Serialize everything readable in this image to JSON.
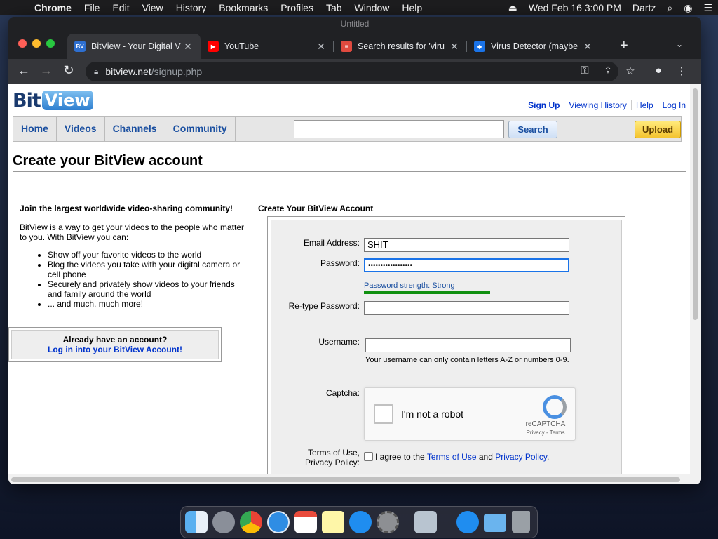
{
  "menubar": {
    "app": "Chrome",
    "items": [
      "File",
      "Edit",
      "View",
      "History",
      "Bookmarks",
      "Profiles",
      "Tab",
      "Window",
      "Help"
    ],
    "datetime": "Wed Feb 16  3:00 PM",
    "user": "Dartz"
  },
  "window": {
    "title": "Untitled"
  },
  "tabs": [
    {
      "title": "BitView - Your Digital V",
      "favicon": "bitview-favicon",
      "color": "#2e6fd0"
    },
    {
      "title": "YouTube",
      "favicon": "youtube-favicon",
      "color": "#ff0000"
    },
    {
      "title": "Search results for 'viru",
      "favicon": "search-favicon",
      "color": "#e04a3f"
    },
    {
      "title": "Virus Detector (maybe",
      "favicon": "shield-favicon",
      "color": "#1a73e8"
    }
  ],
  "omnibox": {
    "host": "bitview.net",
    "path": "/signup.php"
  },
  "site": {
    "logo_bit": "Bit",
    "logo_view": "View",
    "toplinks": [
      "Sign Up",
      "Viewing History",
      "Help",
      "Log In"
    ],
    "nav": [
      "Home",
      "Videos",
      "Channels",
      "Community"
    ],
    "search_button": "Search",
    "upload_button": "Upload"
  },
  "page_title": "Create your BitView account",
  "left": {
    "heading": "Join the largest worldwide video-sharing community!",
    "intro": "BitView is a way to get your videos to the people who matter to you. With BitView you can:",
    "bullets": [
      "Show off your favorite videos to the world",
      "Blog the videos you take with your digital camera or cell phone",
      "Securely and privately show videos to your friends and family around the world",
      "... and much, much more!"
    ],
    "already_heading": "Already have an account?",
    "already_link": "Log in into your BitView Account!"
  },
  "form": {
    "title": "Create Your BitView Account",
    "email_label": "Email Address:",
    "email_value": "SHIT",
    "password_label": "Password:",
    "password_value": "••••••••••••••••••",
    "strength_text": "Password strength: Strong",
    "strength_level": 1.0,
    "strength_color": "#109010",
    "retype_label": "Re-type Password:",
    "username_label": "Username:",
    "username_hint": "Your username can only contain letters A-Z or numbers 0-9.",
    "captcha_label": "Captcha:",
    "captcha_text": "I'm not a robot",
    "captcha_brand": "reCAPTCHA",
    "captcha_links": "Privacy - Terms",
    "tos_label_1": "Terms of Use,",
    "tos_label_2": "Privacy Policy:",
    "tos_prefix": "I agree to the",
    "tos_link": "Terms of Use",
    "tos_and": "and",
    "privacy_link": "Privacy Policy",
    "tos_suffix": "."
  }
}
